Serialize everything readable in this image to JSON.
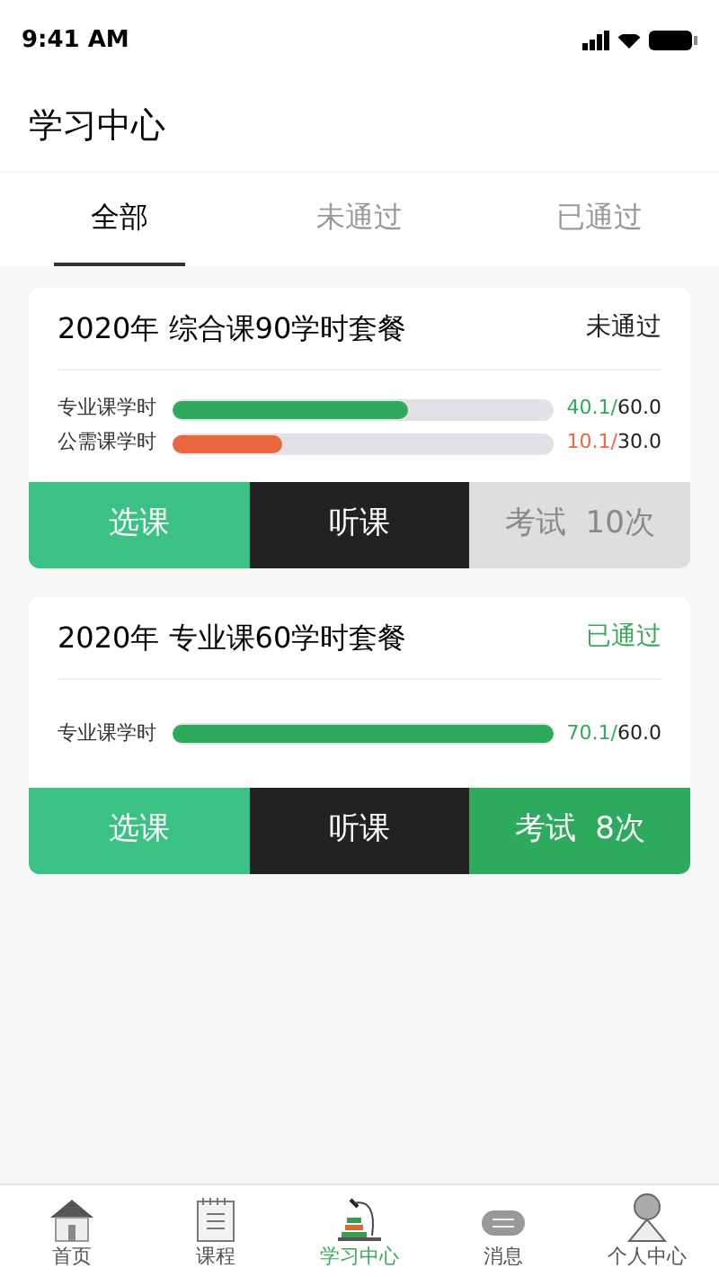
{
  "status_bar": {
    "time": "9:41 AM"
  },
  "header": {
    "title": "学习中心"
  },
  "tabs": [
    {
      "label": "全部",
      "selected": true
    },
    {
      "label": "未通过",
      "selected": false
    },
    {
      "label": "已通过",
      "selected": false
    }
  ],
  "packages": [
    {
      "title": "2020年 综合课90学时套餐",
      "status": "未通过",
      "passed": false,
      "progress": [
        {
          "label": "专业课学时",
          "level": 0.62,
          "color": "#2eaa5c",
          "done": "40.1/",
          "total": "60.0"
        },
        {
          "label": "公需课学时",
          "level": 0.29,
          "color": "#e8673f",
          "done": "10.1/",
          "total": "30.0"
        }
      ],
      "actions": [
        {
          "label": "选课",
          "kind": "select"
        },
        {
          "label": "听课",
          "kind": "listen"
        },
        {
          "label": "考试  10次",
          "kind": "exam",
          "disabled": true
        }
      ]
    },
    {
      "title": "2020年 专业课60学时套餐",
      "status": "已通过",
      "passed": true,
      "progress": [
        {
          "label": "专业课学时",
          "level": 1,
          "color": "#2eaa5c",
          "done": "70.1/",
          "total": "60.0"
        }
      ],
      "actions": [
        {
          "label": "选课",
          "kind": "select"
        },
        {
          "label": "听课",
          "kind": "listen"
        },
        {
          "label": "考试  8次",
          "kind": "exam",
          "disabled": false
        }
      ]
    }
  ],
  "nav": [
    {
      "label": "首页",
      "selected": false
    },
    {
      "label": "课程",
      "selected": false
    },
    {
      "label": "学习中心",
      "selected": true
    },
    {
      "label": "消息",
      "selected": false
    },
    {
      "label": "个人中心",
      "selected": false
    }
  ]
}
